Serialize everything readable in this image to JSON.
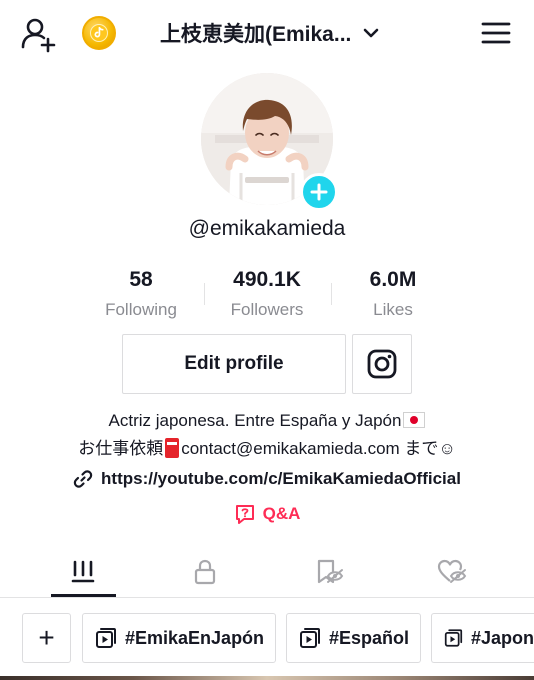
{
  "header": {
    "title": "上枝恵美加(Emika...",
    "icons": [
      "add-user-icon",
      "coin-icon",
      "chevron-down-icon",
      "menu-icon"
    ]
  },
  "profile": {
    "username": "@emikakamieda",
    "avatar_badge": "+"
  },
  "stats": [
    {
      "value": "58",
      "label": "Following"
    },
    {
      "value": "490.1K",
      "label": "Followers"
    },
    {
      "value": "6.0M",
      "label": "Likes"
    }
  ],
  "actions": {
    "edit_profile": "Edit profile",
    "instagram_icon": "instagram-icon"
  },
  "bio": {
    "line1": "Actriz japonesa. Entre España y Japón",
    "line2_prefix": "お仕事依頼",
    "line2_main": "contact@emikakamieda.com まで",
    "line2_emoji": "☺"
  },
  "link": {
    "url": "https://youtube.com/c/EmikaKamiedaOfficial"
  },
  "qa": {
    "label": "Q&A"
  },
  "tabs": [
    {
      "icon": "grid-icon",
      "active": true
    },
    {
      "icon": "lock-icon",
      "active": false
    },
    {
      "icon": "hidden-bookmark-icon",
      "active": false
    },
    {
      "icon": "hidden-heart-icon",
      "active": false
    }
  ],
  "playlists": [
    {
      "label": "+"
    },
    {
      "label": "#EmikaEnJapón"
    },
    {
      "label": "#Español"
    },
    {
      "label": "#Japon"
    }
  ],
  "colors": {
    "accent_red": "#fe2c55",
    "badge_cyan": "#20d5ec",
    "text_primary": "#161823",
    "text_secondary": "#8a8b91"
  }
}
